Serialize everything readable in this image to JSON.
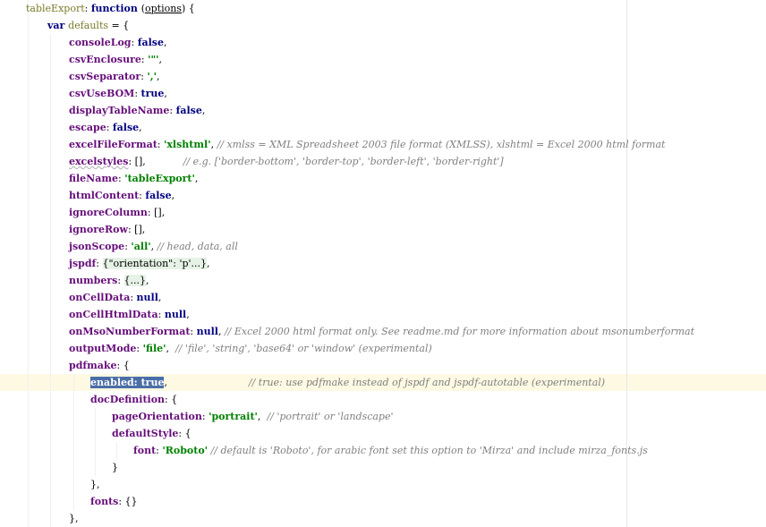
{
  "editor": {
    "lines": [
      [
        [
          "ti",
          "tableExport"
        ],
        [
          "pl",
          ": "
        ],
        [
          "k",
          "function "
        ],
        [
          "pl",
          "("
        ],
        [
          "fn",
          "options"
        ],
        [
          "pl",
          ") {"
        ]
      ],
      [
        [
          "k",
          "var "
        ],
        [
          "ti",
          "defaults"
        ],
        [
          "pl",
          " = {"
        ]
      ],
      [
        [
          "p",
          "consoleLog"
        ],
        [
          "pl",
          ": "
        ],
        [
          "k",
          "false"
        ],
        [
          "pl",
          ","
        ]
      ],
      [
        [
          "p",
          "csvEnclosure"
        ],
        [
          "pl",
          ": "
        ],
        [
          "s",
          "'\"'"
        ],
        [
          "pl",
          ","
        ]
      ],
      [
        [
          "p",
          "csvSeparator"
        ],
        [
          "pl",
          ": "
        ],
        [
          "s",
          "','"
        ],
        [
          "pl",
          ","
        ]
      ],
      [
        [
          "p",
          "csvUseBOM"
        ],
        [
          "pl",
          ": "
        ],
        [
          "k",
          "true"
        ],
        [
          "pl",
          ","
        ]
      ],
      [
        [
          "p",
          "displayTableName"
        ],
        [
          "pl",
          ": "
        ],
        [
          "k",
          "false"
        ],
        [
          "pl",
          ","
        ]
      ],
      [
        [
          "p",
          "escape"
        ],
        [
          "pl",
          ": "
        ],
        [
          "k",
          "false"
        ],
        [
          "pl",
          ","
        ]
      ],
      [
        [
          "p",
          "excelFileFormat"
        ],
        [
          "pl",
          ": "
        ],
        [
          "s",
          "'xlshtml'"
        ],
        [
          "pl",
          ", "
        ],
        [
          "c",
          "// xmlss = XML Spreadsheet 2003 file format (XMLSS), xlshtml = Excel 2000 html format"
        ]
      ],
      [
        [
          "pu",
          "excelstyles"
        ],
        [
          "pl",
          ": [],            "
        ],
        [
          "c",
          "// e.g. ['border-bottom', 'border-top', 'border-left', 'border-right']"
        ]
      ],
      [
        [
          "p",
          "fileName"
        ],
        [
          "pl",
          ": "
        ],
        [
          "s",
          "'tableExport'"
        ],
        [
          "pl",
          ","
        ]
      ],
      [
        [
          "p",
          "htmlContent"
        ],
        [
          "pl",
          ": "
        ],
        [
          "k",
          "false"
        ],
        [
          "pl",
          ","
        ]
      ],
      [
        [
          "p",
          "ignoreColumn"
        ],
        [
          "pl",
          ": [],"
        ]
      ],
      [
        [
          "p",
          "ignoreRow"
        ],
        [
          "pl",
          ": [],"
        ]
      ],
      [
        [
          "p",
          "jsonScope"
        ],
        [
          "pl",
          ": "
        ],
        [
          "s",
          "'all'"
        ],
        [
          "pl",
          ", "
        ],
        [
          "c",
          "// head, data, all"
        ]
      ],
      [
        [
          "p",
          "jspdf"
        ],
        [
          "pl",
          ": "
        ],
        [
          "fold",
          "{\"orientation\": 'p'...}"
        ],
        [
          "pl",
          ","
        ]
      ],
      [
        [
          "p",
          "numbers"
        ],
        [
          "pl",
          ": "
        ],
        [
          "fold",
          "{...}"
        ],
        [
          "pl",
          ","
        ]
      ],
      [
        [
          "p",
          "onCellData"
        ],
        [
          "pl",
          ": "
        ],
        [
          "k",
          "null"
        ],
        [
          "pl",
          ","
        ]
      ],
      [
        [
          "p",
          "onCellHtmlData"
        ],
        [
          "pl",
          ": "
        ],
        [
          "k",
          "null"
        ],
        [
          "pl",
          ","
        ]
      ],
      [
        [
          "p",
          "onMsoNumberFormat"
        ],
        [
          "pl",
          ": "
        ],
        [
          "k",
          "null"
        ],
        [
          "pl",
          ", "
        ],
        [
          "c",
          "// Excel 2000 html format only. See readme.md for more information about msonumberformat"
        ]
      ],
      [
        [
          "p",
          "outputMode"
        ],
        [
          "pl",
          ": "
        ],
        [
          "s",
          "'file'"
        ],
        [
          "pl",
          ",  "
        ],
        [
          "c",
          "// 'file', 'string', 'base64' or 'window' (experimental)"
        ]
      ],
      [
        [
          "p",
          "pdfmake"
        ],
        [
          "pl",
          ": {"
        ]
      ],
      [
        [
          "sel",
          "enabled: true"
        ],
        [
          "pl",
          ",                          "
        ],
        [
          "c",
          "// true: use pdfmake instead of jspdf and jspdf-autotable (experimental)"
        ]
      ],
      [
        [
          "p",
          "docDefinition"
        ],
        [
          "pl",
          ": {"
        ]
      ],
      [
        [
          "p",
          "pageOrientation"
        ],
        [
          "pl",
          ": "
        ],
        [
          "s",
          "'portrait'"
        ],
        [
          "pl",
          ",  "
        ],
        [
          "c",
          "// 'portrait' or 'landscape'"
        ]
      ],
      [
        [
          "p",
          "defaultStyle"
        ],
        [
          "pl",
          ": {"
        ]
      ],
      [
        [
          "p",
          "font"
        ],
        [
          "pl",
          ": "
        ],
        [
          "s",
          "'Roboto'"
        ],
        [
          "pl",
          " "
        ],
        [
          "c",
          "// default is 'Roboto', for arabic font set this option to 'Mirza' and include mirza_fonts.js"
        ]
      ],
      [
        [
          "pl",
          "}"
        ]
      ],
      [
        [
          "pl",
          "},"
        ]
      ],
      [
        [
          "p",
          "fonts"
        ],
        [
          "pl",
          ": {}"
        ]
      ],
      [
        [
          "pl",
          "},"
        ]
      ]
    ]
  }
}
